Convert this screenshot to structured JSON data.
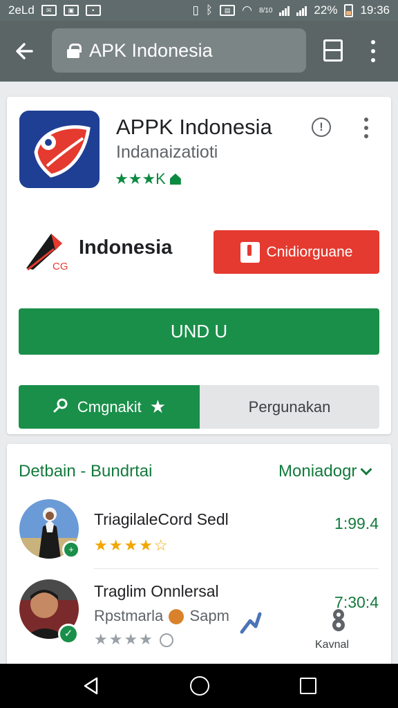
{
  "status_bar": {
    "left_text": "2eLd",
    "battery_percent": "22%",
    "time": "19:36",
    "signal_text": "8/10"
  },
  "toolbar": {
    "url_text": "APK Indonesia"
  },
  "app": {
    "title": "APPK Indonesia",
    "subtitle": "Indanaizatioti",
    "rating_text": "★★★K"
  },
  "brand": {
    "name": "Indonesia",
    "logo_letters": "CG"
  },
  "buttons": {
    "red_label": "Cnidiorguane",
    "install_label": "UND U",
    "toggle_left": "Cmgnakit",
    "toggle_right": "Pergunakan"
  },
  "section": {
    "title": "Detbain - Bundrtai",
    "more_label": "Moniadogr"
  },
  "list": [
    {
      "title": "TriagilaleCord Sedl",
      "value": "1:99.4",
      "stars": "★★★★☆"
    },
    {
      "title": "Traglim Onnlersal",
      "subtitle": "Rpstmarla",
      "subtitle_tail": "Sapm",
      "value": "7:30:4",
      "stars": "★★★★"
    }
  ],
  "overlay": {
    "label": "Kavnal"
  },
  "colors": {
    "green": "#1a8f4a",
    "red": "#e53a2f",
    "toolbar": "#5b6566"
  }
}
